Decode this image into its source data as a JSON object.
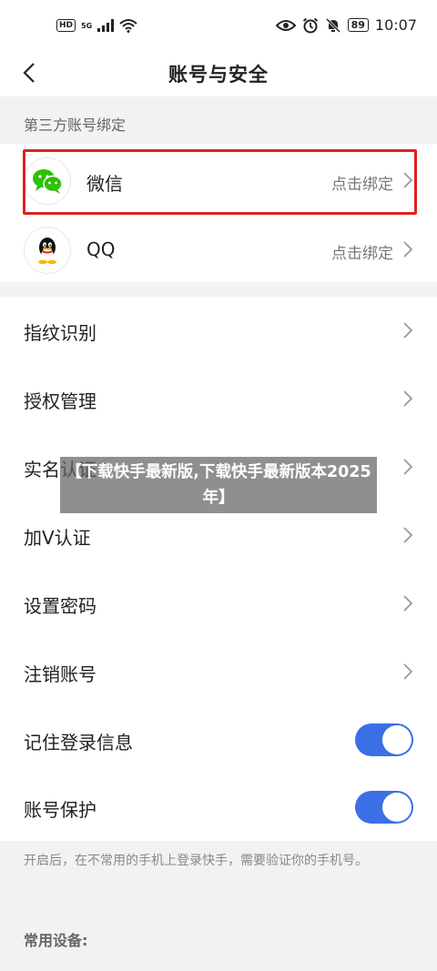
{
  "status_bar": {
    "hd_label": "HD",
    "signal_label": "5G",
    "battery": "89",
    "time": "10:07"
  },
  "nav": {
    "title": "账号与安全"
  },
  "third_party": {
    "header": "第三方账号绑定",
    "accounts": [
      {
        "name": "微信",
        "action": "点击绑定",
        "icon": "wechat-icon",
        "highlighted": true
      },
      {
        "name": "QQ",
        "action": "点击绑定",
        "icon": "qq-icon",
        "highlighted": false
      }
    ]
  },
  "settings": {
    "items": [
      {
        "label": "指纹识别"
      },
      {
        "label": "授权管理"
      },
      {
        "label": "实名认证"
      },
      {
        "label": "加V认证"
      },
      {
        "label": "设置密码"
      },
      {
        "label": "注销账号"
      }
    ],
    "toggles": [
      {
        "label": "记住登录信息",
        "on": true
      },
      {
        "label": "账号保护",
        "on": true
      }
    ]
  },
  "footnote": "开启后，在不常用的手机上登录快手，需要验证你的手机号。",
  "devices_header": "常用设备:",
  "watermark": "【下载快手最新版,下载快手最新版本2025年】",
  "colors": {
    "toggle_on": "#3b6fe6",
    "highlight": "#e02020",
    "wechat_green": "#2dc100"
  }
}
